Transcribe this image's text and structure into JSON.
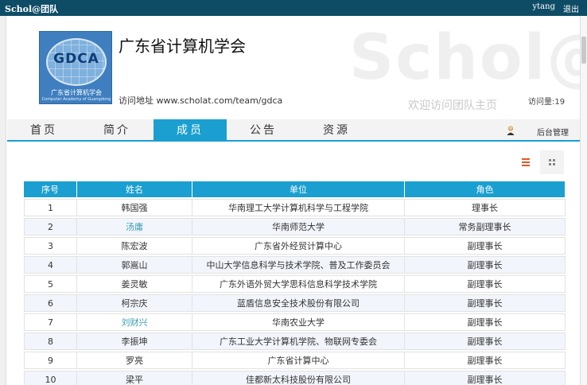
{
  "topbar": {
    "brand": "Schol@团队",
    "user": "ytang",
    "logout": "退出"
  },
  "header": {
    "watermark": "Schol@",
    "logo": {
      "abbr": "GDCA",
      "name_cn": "广东省计算机学会",
      "name_en": "Computer Academy of Guangdong"
    },
    "title": "广东省计算机学会",
    "visit_url": "访问地址 www.scholat.com/team/gdca",
    "welcome": "欢迎访问团队主页",
    "visits": "访问量:19"
  },
  "nav": {
    "tabs": [
      {
        "label": "首页"
      },
      {
        "label": "简介"
      },
      {
        "label": "成员"
      },
      {
        "label": "公告"
      },
      {
        "label": "资源"
      }
    ],
    "active_tab": "成员",
    "admin": "后台管理"
  },
  "table": {
    "columns": [
      "序号",
      "姓名",
      "单位",
      "角色"
    ],
    "rows": [
      {
        "no": "1",
        "name": "韩国强",
        "unit": "华南理工大学计算机科学与工程学院",
        "role": "理事长"
      },
      {
        "no": "2",
        "name": "汤庸",
        "unit": "华南师范大学",
        "role": "常务副理事长"
      },
      {
        "no": "3",
        "name": "陈宏波",
        "unit": "广东省外经贸计算中心",
        "role": "副理事长"
      },
      {
        "no": "4",
        "name": "郭嵩山",
        "unit": "中山大学信息科学与技术学院、普及工作委员会",
        "role": "副理事长"
      },
      {
        "no": "5",
        "name": "姜灵敏",
        "unit": "广东外语外贸大学思科信息科学技术学院",
        "role": "副理事长"
      },
      {
        "no": "6",
        "name": "柯宗庆",
        "unit": "蓝盾信息安全技术股份有限公司",
        "role": "副理事长"
      },
      {
        "no": "7",
        "name": "刘财兴",
        "unit": "华南农业大学",
        "role": "副理事长"
      },
      {
        "no": "8",
        "name": "李振坤",
        "unit": "广东工业大学计算机学院、物联网专委会",
        "role": "副理事长"
      },
      {
        "no": "9",
        "name": "罗亮",
        "unit": "广东省计算中心",
        "role": "副理事长"
      },
      {
        "no": "10",
        "name": "梁平",
        "unit": "佳都新太科技股份有限公司",
        "role": "副理事长"
      }
    ]
  },
  "colors": {
    "topbar": "#0e4c66",
    "accent": "#1a9fd0",
    "link": "#3a9ab5",
    "list_icon": "#e0592a"
  },
  "icons": {
    "list_view": "list-icon",
    "grid_view": "grid-icon",
    "admin": "user-icon"
  }
}
